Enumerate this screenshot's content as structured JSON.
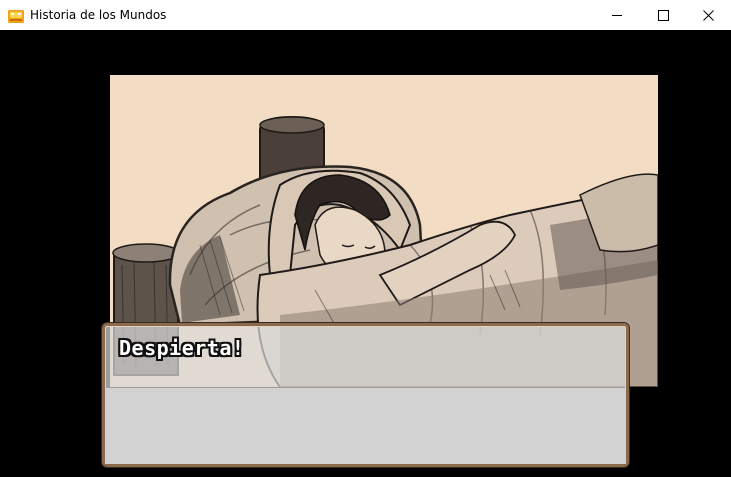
{
  "window": {
    "title": "Historia de los Mundos",
    "app_icon": "rpg-maker-icon",
    "controls": {
      "minimize_icon": "minimize-icon",
      "maximize_icon": "maximize-icon",
      "close_icon": "close-icon"
    }
  },
  "scene": {
    "image": "sketch-sleeping-girl-in-bed",
    "background_color": "#f2dcc3"
  },
  "message": {
    "text": "Despierta!"
  },
  "colors": {
    "game_background": "#000000",
    "titlebar": "#ffffff",
    "message_border": "#8a6a4e",
    "message_fill": "#d2d2d2"
  }
}
